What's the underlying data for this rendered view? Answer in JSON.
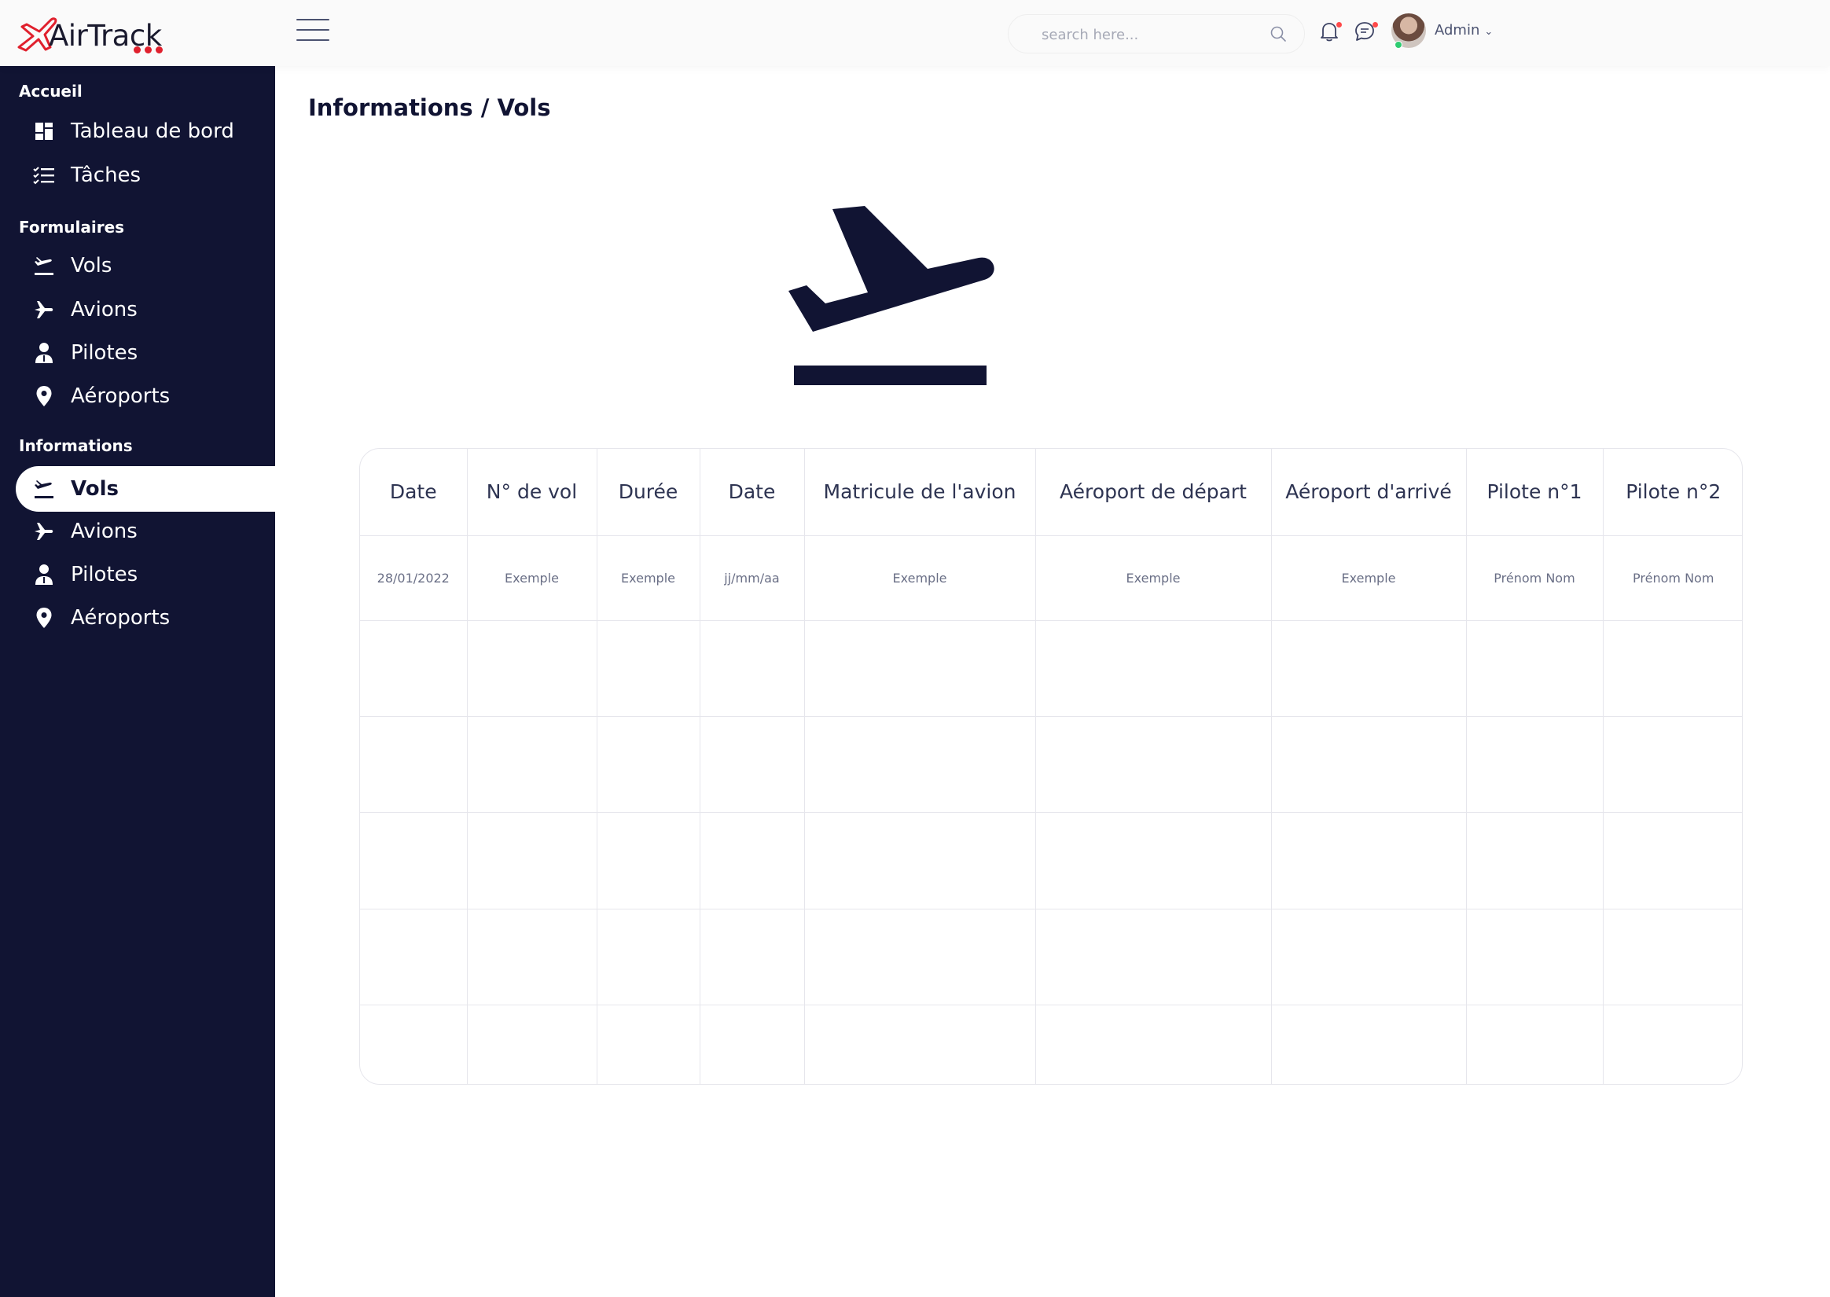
{
  "app": {
    "name": "AirTrack"
  },
  "header": {
    "search_placeholder": "search here...",
    "user_name": "Admin"
  },
  "sidebar": {
    "sections": [
      {
        "title": "Accueil",
        "items": [
          {
            "label": "Tableau de bord",
            "icon": "dashboard-icon"
          },
          {
            "label": "Tâches",
            "icon": "checklist-icon"
          }
        ]
      },
      {
        "title": "Formulaires",
        "items": [
          {
            "label": "Vols",
            "icon": "flight-takeoff-icon"
          },
          {
            "label": "Avions",
            "icon": "airplane-icon"
          },
          {
            "label": "Pilotes",
            "icon": "pilot-icon"
          },
          {
            "label": "Aéroports",
            "icon": "location-pin-icon"
          }
        ]
      },
      {
        "title": "Informations",
        "items": [
          {
            "label": "Vols",
            "icon": "flight-takeoff-icon",
            "active": true
          },
          {
            "label": "Avions",
            "icon": "airplane-icon"
          },
          {
            "label": "Pilotes",
            "icon": "pilot-icon"
          },
          {
            "label": "Aéroports",
            "icon": "location-pin-icon"
          }
        ]
      }
    ]
  },
  "main": {
    "title": "Informations / Vols",
    "hero_icon": "flight-takeoff-icon",
    "table": {
      "headers": [
        "Date",
        "N° de vol",
        "Durée",
        "Date",
        "Matricule de l'avion",
        "Aéroport de départ",
        "Aéroport d'arrivé",
        "Pilote n°1",
        "Pilote n°2"
      ],
      "rows": [
        [
          "28/01/2022",
          "Exemple",
          "Exemple",
          "jj/mm/aa",
          "Exemple",
          "Exemple",
          "Exemple",
          "Prénom Nom",
          "Prénom Nom"
        ]
      ],
      "empty_rows": 5
    }
  },
  "colors": {
    "sidebar_bg": "#111433",
    "accent": "#e0202d",
    "text_dark": "#111433"
  }
}
